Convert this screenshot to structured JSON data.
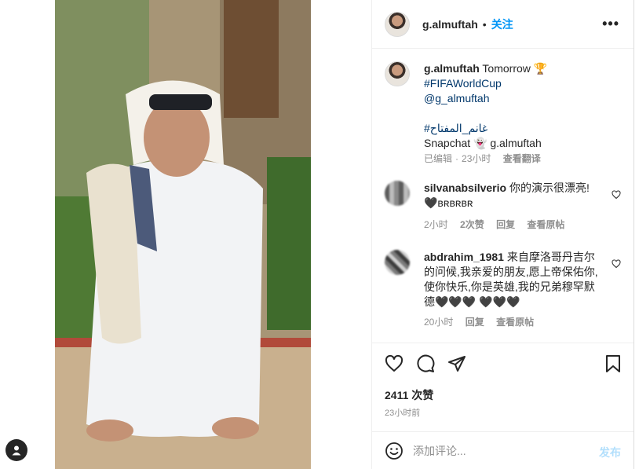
{
  "header": {
    "username": "g.almuftah",
    "separator": "•",
    "follow_label": "关注",
    "more_label": "•••"
  },
  "caption": {
    "username": "g.almuftah",
    "line1_text": "Tomorrow 🏆",
    "hashtag1": "#FIFAWorldCup",
    "mention": "@g_almuftah",
    "hashtag2": "#غانم_المفتاح",
    "snapchat_text": "Snapchat 👻 g.almuftah",
    "edited": "已编辑",
    "time": "23小时",
    "see_translation": "查看翻译"
  },
  "comments": [
    {
      "username": "silvanabsilverio",
      "text": "你的演示很漂亮!",
      "text2": "🖤ʙʀʙʀʙʀ",
      "time": "2小时",
      "likes": "2次赞",
      "reply": "回复",
      "see_original": "查看原帖"
    },
    {
      "username": "abdrahim_1981",
      "text": "来自摩洛哥丹吉尔的问候,我亲爱的朋友,愿上帝保佑你,使你快乐,你是英雄,我的兄弟穆罕默德🖤🖤🖤 🖤🖤🖤",
      "time": "20小时",
      "reply": "回复",
      "see_original": "查看原帖"
    }
  ],
  "post": {
    "likes": "2411 次赞",
    "time": "23小时前"
  },
  "add_comment": {
    "placeholder": "添加评论...",
    "post_label": "发布"
  },
  "colors": {
    "accent": "#0095f6",
    "post_disabled": "#b2dffc",
    "hashtag": "#00376b",
    "muted": "#8e8e8e"
  }
}
